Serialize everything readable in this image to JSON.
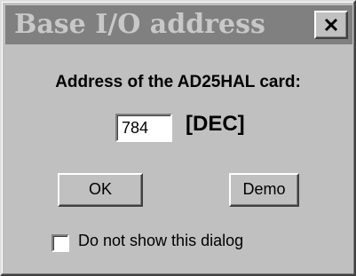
{
  "dialog": {
    "title": "Base I/O address",
    "close_icon": "close-icon",
    "prompt": "Address of the AD25HAL card:",
    "address_value": "784",
    "unit_label": "[DEC]",
    "ok_label": "OK",
    "demo_label": "Demo",
    "dont_show_label": "Do not show this dialog",
    "dont_show_checked": false
  }
}
